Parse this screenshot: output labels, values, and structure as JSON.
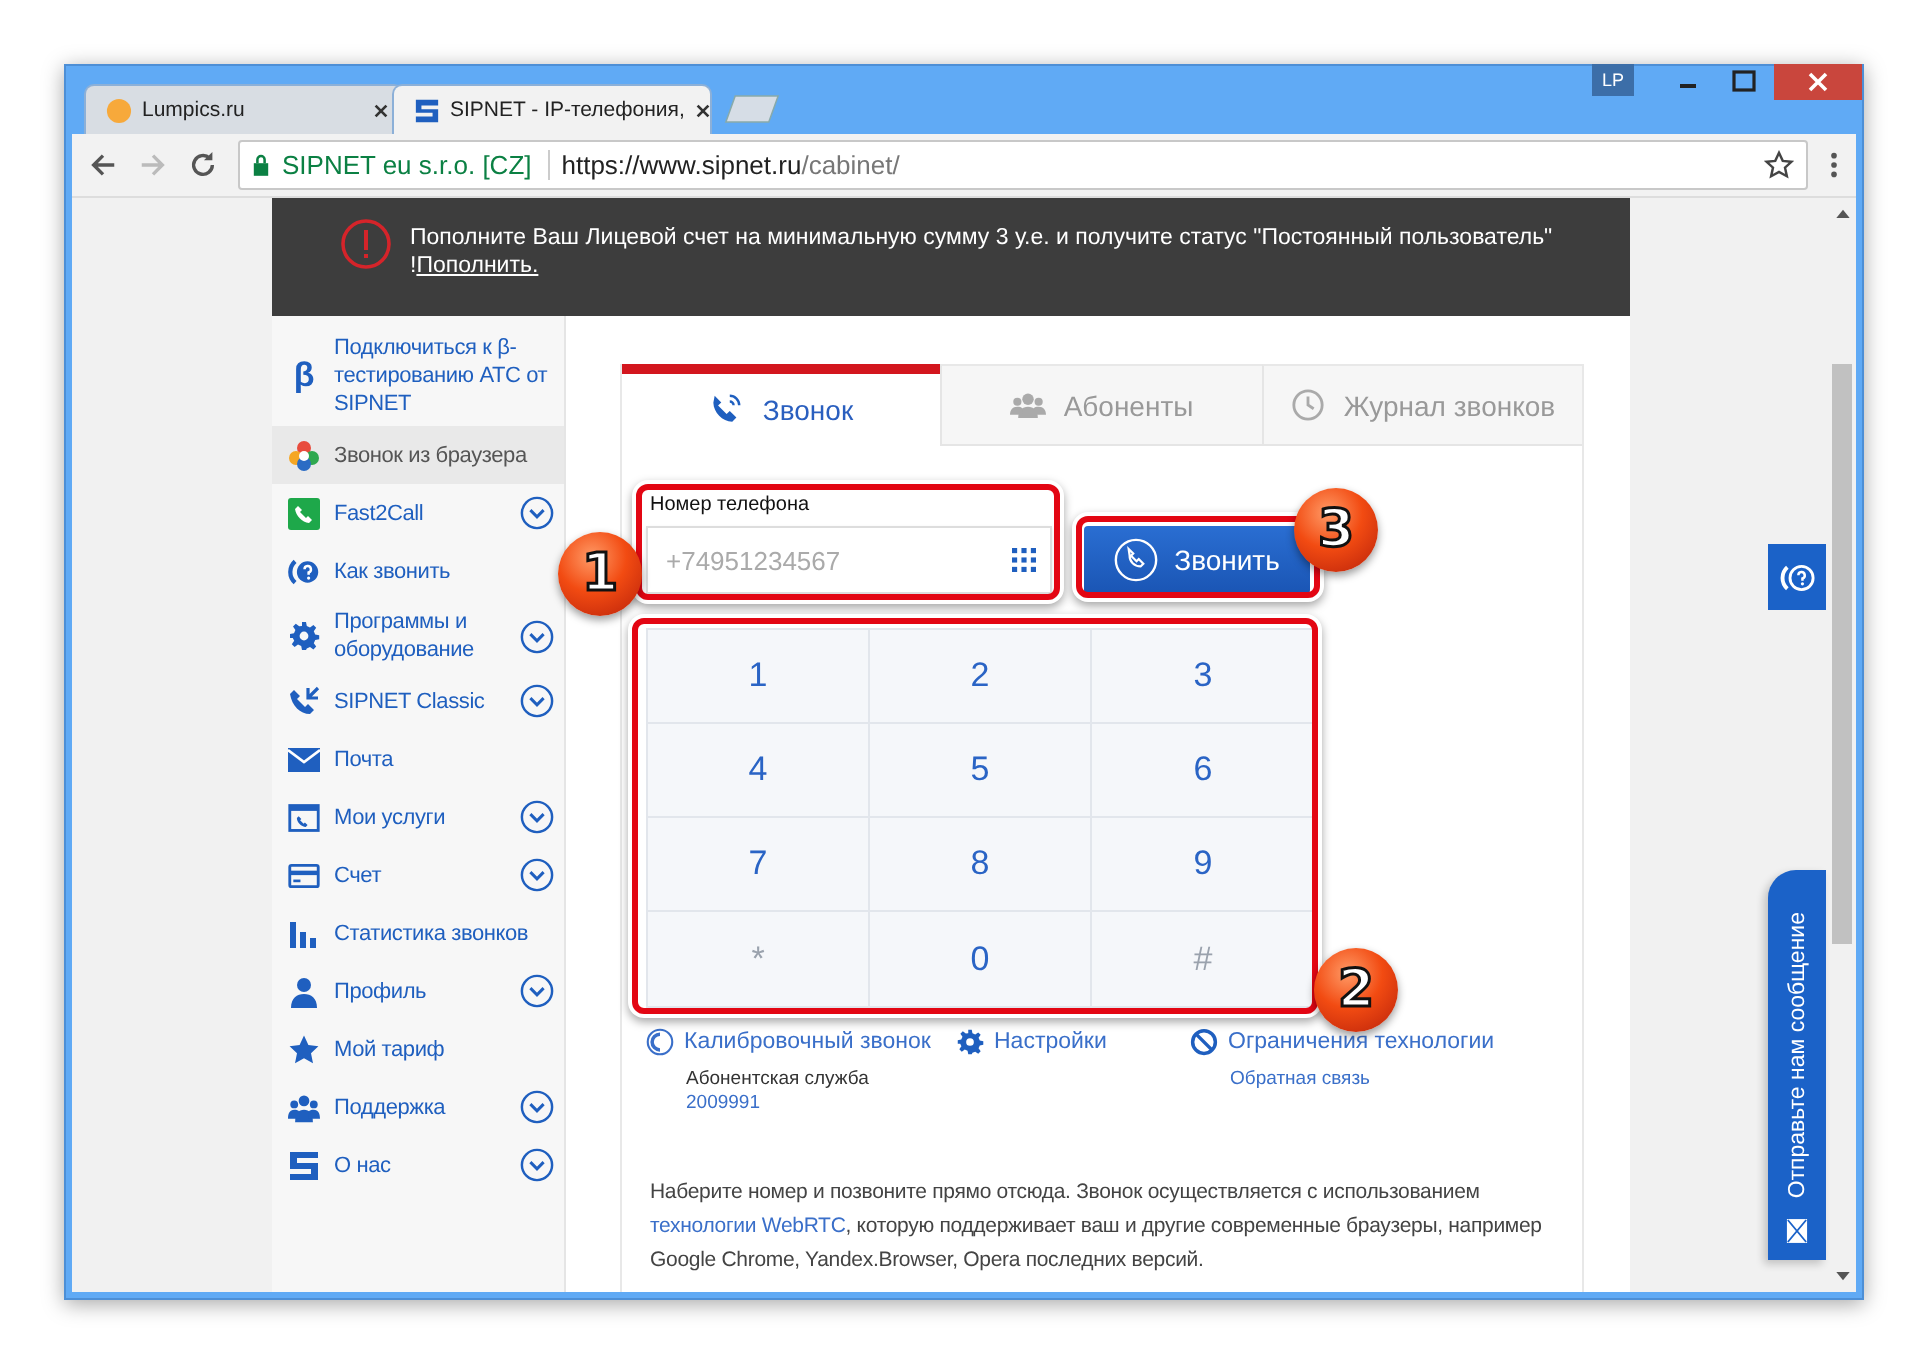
{
  "browser": {
    "tabs": [
      {
        "title": "Lumpics.ru",
        "kind": "plain",
        "selected": false
      },
      {
        "title": "SIPNET - IP-телефония,",
        "kind": "sipnet",
        "selected": true
      }
    ],
    "profile": "LP",
    "security": "SIPNET eu s.r.o. [CZ]",
    "url_host": "https://www.sipnet.ru",
    "url_path": "/cabinet/"
  },
  "banner": {
    "message": "Пополните Ваш Лицевой счет на минимальную сумму 3 у.е. и получите статус \"Постоянный пользователь\"",
    "suffix": "!",
    "link": "Пополнить."
  },
  "sidebar": {
    "items": [
      {
        "kind": "beta",
        "glyph": "β",
        "label": "Подключиться к β-тестированию АТС от SIPNET",
        "selected": false,
        "expandable": false
      },
      {
        "kind": "browser",
        "label": "Звонок из браузера",
        "selected": true,
        "expandable": false
      },
      {
        "kind": "fast2call",
        "label": "Fast2Call",
        "selected": false,
        "expandable": true
      },
      {
        "kind": "howto",
        "label": "Как звонить",
        "selected": false,
        "expandable": false
      },
      {
        "kind": "gear",
        "label": "Программы и оборудование",
        "selected": false,
        "expandable": true
      },
      {
        "kind": "classic",
        "label": "SIPNET Classic",
        "selected": false,
        "expandable": true
      },
      {
        "kind": "mail",
        "label": "Почта",
        "selected": false,
        "expandable": false
      },
      {
        "kind": "services",
        "label": "Мои услуги",
        "selected": false,
        "expandable": true
      },
      {
        "kind": "card",
        "label": "Счет",
        "selected": false,
        "expandable": true
      },
      {
        "kind": "stats",
        "label": "Статистика звонков",
        "selected": false,
        "expandable": false
      },
      {
        "kind": "profile",
        "label": "Профиль",
        "selected": false,
        "expandable": true
      },
      {
        "kind": "star",
        "label": "Мой тариф",
        "selected": false,
        "expandable": false
      },
      {
        "kind": "group",
        "label": "Поддержка",
        "selected": false,
        "expandable": true
      },
      {
        "kind": "logo",
        "label": "О нас",
        "selected": false,
        "expandable": true
      }
    ]
  },
  "phone_tabs": [
    {
      "kind": "call",
      "label": "Звонок",
      "selected": true
    },
    {
      "kind": "group",
      "label": "Абоненты",
      "selected": false
    },
    {
      "kind": "clock",
      "label": "Журнал звонков",
      "selected": false
    }
  ],
  "phone_field": {
    "label": "Номер телефона",
    "placeholder": "+74951234567"
  },
  "call_button": "Звонить",
  "keypad": [
    {
      "label": "1",
      "disabled": false
    },
    {
      "label": "2",
      "disabled": false
    },
    {
      "label": "3",
      "disabled": false
    },
    {
      "label": "4",
      "disabled": false
    },
    {
      "label": "5",
      "disabled": false
    },
    {
      "label": "6",
      "disabled": false
    },
    {
      "label": "7",
      "disabled": false
    },
    {
      "label": "8",
      "disabled": false
    },
    {
      "label": "9",
      "disabled": false
    },
    {
      "label": "*",
      "disabled": true
    },
    {
      "label": "0",
      "disabled": false
    },
    {
      "label": "#",
      "disabled": true
    }
  ],
  "links": [
    {
      "kind": "call",
      "label": "Калибровочный звонок",
      "note": "Абонентская служба",
      "note_link": "2009991"
    },
    {
      "kind": "gear",
      "label": "Настройки"
    },
    {
      "kind": "forbidden",
      "label": "Ограничения технологии",
      "note_link": "Обратная связь"
    }
  ],
  "description": {
    "before": "Наберите номер и позвоните прямо отсюда. Звонок осуществляется с использованием ",
    "link": "технологии WebRTC",
    "after": ", которую поддерживает ваш и другие современные браузеры, например Google Chrome, Yandex.Browser, Opera последних версий."
  },
  "feedback_tab": "Отправьте нам сообщение",
  "callouts": [
    "1",
    "2",
    "3"
  ]
}
